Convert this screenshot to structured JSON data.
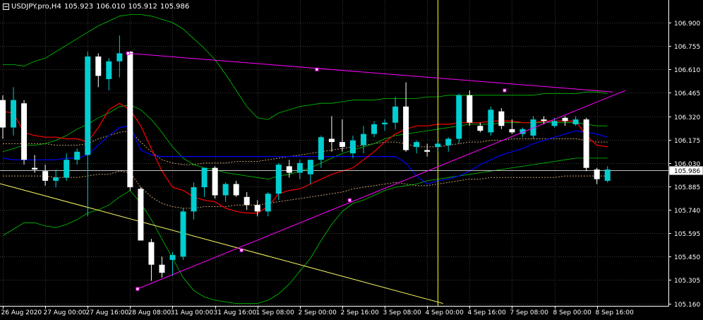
{
  "header": {
    "symbol": "USDJPY.pro,H4",
    "open": "105.923",
    "high": "106.010",
    "low": "105.912",
    "close": "105.986",
    "icon": "chart-window-icon"
  },
  "colors": {
    "background": "#000000",
    "bull_candle": "#00CED1",
    "bear_candle": "#FFFFFF",
    "grid": "#3a3a3a",
    "axis_text": "#FFFFFF",
    "price_line": "#C0C0C0",
    "trend_magenta": "#FF00FF",
    "trend_yellow": "#FFFF66",
    "vertical_line": "#FFFF00",
    "ma_red": "#FF0000",
    "ma_blue": "#0000FF",
    "band_green": "#00C800",
    "envelope_orange": "#C8A070"
  },
  "chart_data": {
    "type": "candlestick",
    "y_axis": {
      "labels": [
        "106.900",
        "106.755",
        "106.610",
        "106.465",
        "106.320",
        "106.175",
        "106.030",
        "105.885",
        "105.740",
        "105.595",
        "105.450",
        "105.305",
        "105.160"
      ],
      "range": [
        105.145,
        107.04
      ]
    },
    "x_axis": {
      "labels": [
        "26 Aug 2020",
        "27 Aug 00:00",
        "27 Aug 16:00",
        "28 Aug 08:00",
        "31 Aug 00:00",
        "31 Aug 16:00",
        "1 Sep 08:00",
        "2 Sep 00:00",
        "2 Sep 16:00",
        "3 Sep 08:00",
        "4 Sep 00:00",
        "4 Sep 16:00",
        "7 Sep 08:00",
        "8 Sep 00:00",
        "8 Sep 16:00"
      ]
    },
    "current_price": "105.986",
    "candles": [
      {
        "o": 106.42,
        "h": 106.45,
        "l": 106.18,
        "c": 106.25
      },
      {
        "o": 106.25,
        "h": 106.5,
        "l": 106.2,
        "c": 106.42
      },
      {
        "o": 106.4,
        "h": 106.42,
        "l": 106.02,
        "c": 106.05
      },
      {
        "o": 106.0,
        "h": 106.08,
        "l": 105.97,
        "c": 105.99
      },
      {
        "o": 105.98,
        "h": 106.02,
        "l": 105.89,
        "c": 105.92
      },
      {
        "o": 105.92,
        "h": 105.99,
        "l": 105.88,
        "c": 105.94
      },
      {
        "o": 105.94,
        "h": 106.09,
        "l": 105.92,
        "c": 106.05
      },
      {
        "o": 106.05,
        "h": 106.12,
        "l": 106.02,
        "c": 106.1
      },
      {
        "o": 106.08,
        "h": 106.72,
        "l": 105.7,
        "c": 106.69
      },
      {
        "o": 106.69,
        "h": 106.71,
        "l": 106.5,
        "c": 106.57
      },
      {
        "o": 106.55,
        "h": 106.68,
        "l": 106.48,
        "c": 106.66
      },
      {
        "o": 106.66,
        "h": 106.82,
        "l": 106.56,
        "c": 106.71
      },
      {
        "o": 106.72,
        "h": 106.72,
        "l": 105.86,
        "c": 105.88
      },
      {
        "o": 105.87,
        "h": 105.88,
        "l": 105.55,
        "c": 105.55
      },
      {
        "o": 105.54,
        "h": 105.56,
        "l": 105.3,
        "c": 105.4
      },
      {
        "o": 105.4,
        "h": 105.45,
        "l": 105.32,
        "c": 105.35
      },
      {
        "o": 105.43,
        "h": 105.48,
        "l": 105.33,
        "c": 105.46
      },
      {
        "o": 105.45,
        "h": 105.75,
        "l": 105.43,
        "c": 105.73
      },
      {
        "o": 105.73,
        "h": 105.91,
        "l": 105.68,
        "c": 105.88
      },
      {
        "o": 105.88,
        "h": 106.0,
        "l": 105.82,
        "c": 106.0
      },
      {
        "o": 106.0,
        "h": 106.01,
        "l": 105.81,
        "c": 105.83
      },
      {
        "o": 105.83,
        "h": 105.91,
        "l": 105.79,
        "c": 105.9
      },
      {
        "o": 105.9,
        "h": 105.92,
        "l": 105.82,
        "c": 105.83
      },
      {
        "o": 105.82,
        "h": 105.85,
        "l": 105.74,
        "c": 105.77
      },
      {
        "o": 105.77,
        "h": 105.8,
        "l": 105.7,
        "c": 105.73
      },
      {
        "o": 105.73,
        "h": 105.85,
        "l": 105.7,
        "c": 105.84
      },
      {
        "o": 105.84,
        "h": 106.03,
        "l": 105.8,
        "c": 106.02
      },
      {
        "o": 106.01,
        "h": 106.05,
        "l": 105.94,
        "c": 105.97
      },
      {
        "o": 105.97,
        "h": 106.05,
        "l": 105.93,
        "c": 106.03
      },
      {
        "o": 105.96,
        "h": 106.05,
        "l": 105.9,
        "c": 106.05
      },
      {
        "o": 106.05,
        "h": 106.2,
        "l": 106.0,
        "c": 106.19
      },
      {
        "o": 106.18,
        "h": 106.32,
        "l": 106.1,
        "c": 106.16
      },
      {
        "o": 106.16,
        "h": 106.3,
        "l": 106.1,
        "c": 106.13
      },
      {
        "o": 106.09,
        "h": 106.2,
        "l": 106.06,
        "c": 106.17
      },
      {
        "o": 106.14,
        "h": 106.26,
        "l": 106.09,
        "c": 106.21
      },
      {
        "o": 106.21,
        "h": 106.29,
        "l": 106.19,
        "c": 106.27
      },
      {
        "o": 106.27,
        "h": 106.3,
        "l": 106.23,
        "c": 106.28
      },
      {
        "o": 106.28,
        "h": 106.44,
        "l": 106.24,
        "c": 106.38
      },
      {
        "o": 106.38,
        "h": 106.53,
        "l": 106.1,
        "c": 106.11
      },
      {
        "o": 106.13,
        "h": 106.17,
        "l": 106.09,
        "c": 106.16
      },
      {
        "o": 106.11,
        "h": 106.15,
        "l": 106.07,
        "c": 106.1
      },
      {
        "o": 106.13,
        "h": 106.16,
        "l": 106.1,
        "c": 106.15
      },
      {
        "o": 106.14,
        "h": 106.19,
        "l": 106.1,
        "c": 106.18
      },
      {
        "o": 106.18,
        "h": 106.46,
        "l": 106.15,
        "c": 106.45
      },
      {
        "o": 106.45,
        "h": 106.48,
        "l": 106.26,
        "c": 106.28
      },
      {
        "o": 106.26,
        "h": 106.28,
        "l": 106.22,
        "c": 106.23
      },
      {
        "o": 106.22,
        "h": 106.38,
        "l": 106.2,
        "c": 106.36
      },
      {
        "o": 106.35,
        "h": 106.37,
        "l": 106.24,
        "c": 106.26
      },
      {
        "o": 106.24,
        "h": 106.3,
        "l": 106.21,
        "c": 106.22
      },
      {
        "o": 106.21,
        "h": 106.25,
        "l": 106.19,
        "c": 106.24
      },
      {
        "o": 106.2,
        "h": 106.32,
        "l": 106.18,
        "c": 106.3
      },
      {
        "o": 106.3,
        "h": 106.32,
        "l": 106.27,
        "c": 106.29
      },
      {
        "o": 106.26,
        "h": 106.31,
        "l": 106.25,
        "c": 106.29
      },
      {
        "o": 106.31,
        "h": 106.32,
        "l": 106.26,
        "c": 106.29
      },
      {
        "o": 106.27,
        "h": 106.32,
        "l": 106.26,
        "c": 106.3
      },
      {
        "o": 106.3,
        "h": 106.31,
        "l": 105.98,
        "c": 106.0
      },
      {
        "o": 105.99,
        "h": 106.0,
        "l": 105.9,
        "c": 105.93
      },
      {
        "o": 105.92,
        "h": 106.01,
        "l": 105.91,
        "c": 105.99
      }
    ],
    "overlays": {
      "ma_red": [
        106.35,
        106.34,
        106.22,
        106.2,
        106.19,
        106.19,
        106.18,
        106.18,
        106.16,
        106.25,
        106.36,
        106.4,
        106.36,
        106.26,
        106.12,
        105.98,
        105.88,
        105.86,
        105.82,
        105.8,
        105.79,
        105.75,
        105.73,
        105.72,
        105.72,
        105.76,
        105.84,
        105.86,
        105.87,
        105.9,
        105.93,
        105.96,
        105.98,
        106.0,
        106.05,
        106.1,
        106.16,
        106.21,
        106.24,
        106.26,
        106.26,
        106.27,
        106.27,
        106.28,
        106.28,
        106.28,
        106.29,
        106.29,
        106.29,
        106.28,
        106.28,
        106.29,
        106.29,
        106.29,
        106.29,
        106.2,
        106.14,
        106.13
      ],
      "ma_blue": [
        106.06,
        106.05,
        106.05,
        106.05,
        106.05,
        106.05,
        106.06,
        106.06,
        106.08,
        106.14,
        106.2,
        106.25,
        106.26,
        106.11,
        106.08,
        106.07,
        106.07,
        106.07,
        106.07,
        106.07,
        106.07,
        106.07,
        106.07,
        106.07,
        106.07,
        106.07,
        106.07,
        106.07,
        106.07,
        106.07,
        106.07,
        106.07,
        106.07,
        106.07,
        106.07,
        106.07,
        106.07,
        106.07,
        106.03,
        105.95,
        105.9,
        105.92,
        105.93,
        105.95,
        105.98,
        106.02,
        106.05,
        106.08,
        106.1,
        106.12,
        106.15,
        106.17,
        106.19,
        106.21,
        106.23,
        106.22,
        106.21,
        106.19
      ],
      "band_upper": [
        106.64,
        106.64,
        106.63,
        106.66,
        106.68,
        106.72,
        106.76,
        106.8,
        106.84,
        106.88,
        106.91,
        106.94,
        106.95,
        106.95,
        106.94,
        106.92,
        106.9,
        106.86,
        106.8,
        106.74,
        106.67,
        106.58,
        106.48,
        106.38,
        106.31,
        106.3,
        106.34,
        106.36,
        106.38,
        106.39,
        106.4,
        106.4,
        106.41,
        106.42,
        106.42,
        106.42,
        106.43,
        106.43,
        106.43,
        106.43,
        106.44,
        106.44,
        106.45,
        106.45,
        106.45,
        106.45,
        106.45,
        106.45,
        106.45,
        106.45,
        106.45,
        106.46,
        106.46,
        106.46,
        106.46,
        106.47,
        106.47,
        106.46
      ],
      "band_mid": [
        106.1,
        106.12,
        106.14,
        106.14,
        106.15,
        106.17,
        106.2,
        106.24,
        106.27,
        106.31,
        106.34,
        106.38,
        106.39,
        106.36,
        106.3,
        106.22,
        106.13,
        106.06,
        106.02,
        106.0,
        105.99,
        105.97,
        105.96,
        105.95,
        105.94,
        105.93,
        105.95,
        105.96,
        105.98,
        106.0,
        106.03,
        106.06,
        106.09,
        106.11,
        106.13,
        106.15,
        106.18,
        106.2,
        106.21,
        106.22,
        106.23,
        106.24,
        106.25,
        106.26,
        106.27,
        106.27,
        106.27,
        106.28,
        106.28,
        106.28,
        106.28,
        106.28,
        106.28,
        106.28,
        106.28,
        106.27,
        106.26,
        106.26
      ],
      "band_lower": [
        105.58,
        105.62,
        105.66,
        105.66,
        105.64,
        105.63,
        105.65,
        105.68,
        105.72,
        105.74,
        105.77,
        105.82,
        105.86,
        105.78,
        105.68,
        105.56,
        105.44,
        105.32,
        105.24,
        105.2,
        105.18,
        105.17,
        105.16,
        105.16,
        105.16,
        105.18,
        105.22,
        105.28,
        105.36,
        105.44,
        105.55,
        105.65,
        105.73,
        105.78,
        105.8,
        105.83,
        105.86,
        105.88,
        105.89,
        105.9,
        105.92,
        105.93,
        105.94,
        105.95,
        105.96,
        105.97,
        105.98,
        105.99,
        106.0,
        106.01,
        106.02,
        106.03,
        106.04,
        106.05,
        106.06,
        106.06,
        106.06,
        106.06
      ],
      "envelope_upper": [
        106.15,
        106.15,
        106.15,
        106.15,
        106.15,
        106.14,
        106.14,
        106.14,
        106.15,
        106.18,
        106.2,
        106.22,
        106.23,
        106.16,
        106.1,
        106.05,
        106.03,
        106.02,
        106.02,
        106.03,
        106.03,
        106.03,
        106.04,
        106.04,
        106.04,
        106.05,
        106.06,
        106.07,
        106.08,
        106.09,
        106.1,
        106.11,
        106.12,
        106.13,
        106.14,
        106.15,
        106.16,
        106.16,
        106.15,
        106.13,
        106.13,
        106.13,
        106.14,
        106.15,
        106.16,
        106.16,
        106.17,
        106.17,
        106.18,
        106.18,
        106.18,
        106.18,
        106.18,
        106.18,
        106.18,
        106.17,
        106.16,
        106.16
      ],
      "envelope_lower": [
        105.95,
        105.95,
        105.95,
        105.95,
        105.95,
        105.94,
        105.94,
        105.94,
        105.95,
        105.96,
        105.96,
        105.98,
        105.97,
        105.88,
        105.82,
        105.78,
        105.76,
        105.75,
        105.75,
        105.76,
        105.76,
        105.76,
        105.77,
        105.77,
        105.77,
        105.78,
        105.79,
        105.8,
        105.81,
        105.82,
        105.83,
        105.84,
        105.85,
        105.87,
        105.88,
        105.89,
        105.9,
        105.91,
        105.9,
        105.89,
        105.89,
        105.9,
        105.91,
        105.92,
        105.93,
        105.93,
        105.94,
        105.94,
        105.94,
        105.94,
        105.94,
        105.94,
        105.94,
        105.95,
        105.95,
        105.95,
        105.95,
        105.95
      ]
    },
    "drawings": {
      "magenta_upper": [
        [
          11.8,
          106.71
        ],
        [
          57.5,
          106.47
        ]
      ],
      "magenta_lower": [
        [
          12.7,
          105.25
        ],
        [
          58.7,
          106.48
        ]
      ],
      "yellow_trend": [
        [
          -0.7,
          105.91
        ],
        [
          41.5,
          105.16
        ]
      ],
      "vertical_line_index": 41.0,
      "magenta_points": [
        [
          11.8,
          106.71
        ],
        [
          29.6,
          106.61
        ],
        [
          47.3,
          106.48
        ],
        [
          12.7,
          105.25
        ],
        [
          22.5,
          105.49
        ],
        [
          32.7,
          105.8
        ]
      ]
    }
  }
}
